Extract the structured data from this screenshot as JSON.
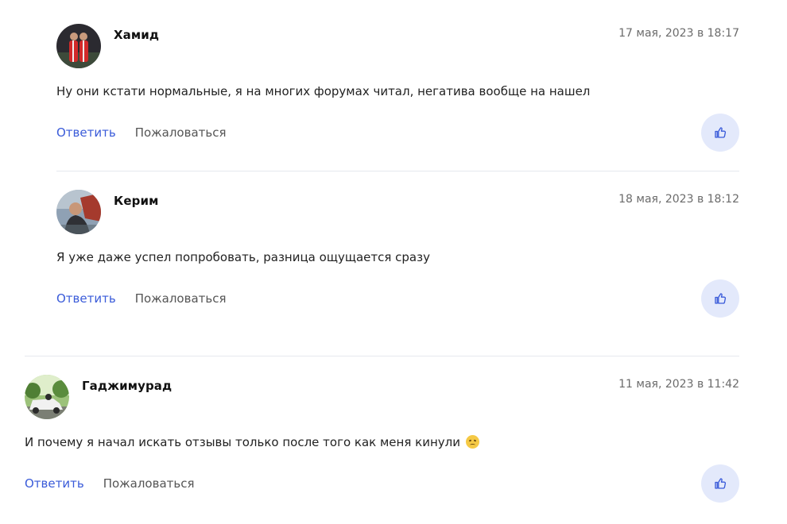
{
  "comments": [
    {
      "author": "Хамид",
      "date": "17 мая, 2023 в 18:17",
      "text": "Ну они кстати нормальные, я на многих форумах читал, негатива вообще на нашел",
      "reply_label": "Ответить",
      "report_label": "Пожаловаться"
    },
    {
      "author": "Керим",
      "date": "18 мая, 2023 в 18:12",
      "text": "Я уже даже успел попробовать, разница ощущается сразу",
      "reply_label": "Ответить",
      "report_label": "Пожаловаться"
    },
    {
      "author": "Гаджимурад",
      "date": "11 мая, 2023 в 11:42",
      "text": "И почему я начал искать отзывы только после того как меня кинули",
      "emoji": "disappointed-face",
      "reply_label": "Ответить",
      "report_label": "Пожаловаться"
    }
  ],
  "icons": {
    "like": "thumbs-up-icon"
  },
  "colors": {
    "link": "#3a5bd9",
    "like_bg": "#e3e9fb",
    "divider": "#e6e9ee"
  }
}
